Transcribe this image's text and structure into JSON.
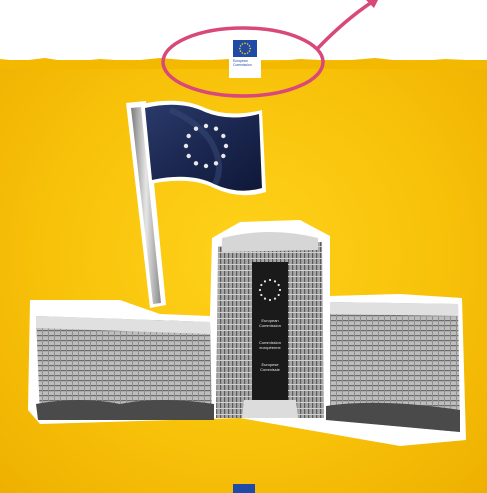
{
  "logo": {
    "line1": "European",
    "line2": "Commission"
  },
  "banner": {
    "line1": "European",
    "line2": "Commission",
    "line3": "Commission",
    "line4": "européenne",
    "line5": "Europese",
    "line6": "Commissie"
  },
  "colors": {
    "background": "#f8c20a",
    "eu_blue": "#1f4aa8",
    "eu_gold": "#ffd400",
    "highlight": "#d9487a"
  },
  "icons": [
    "eu-flag-icon",
    "highlight-arrow-icon"
  ]
}
